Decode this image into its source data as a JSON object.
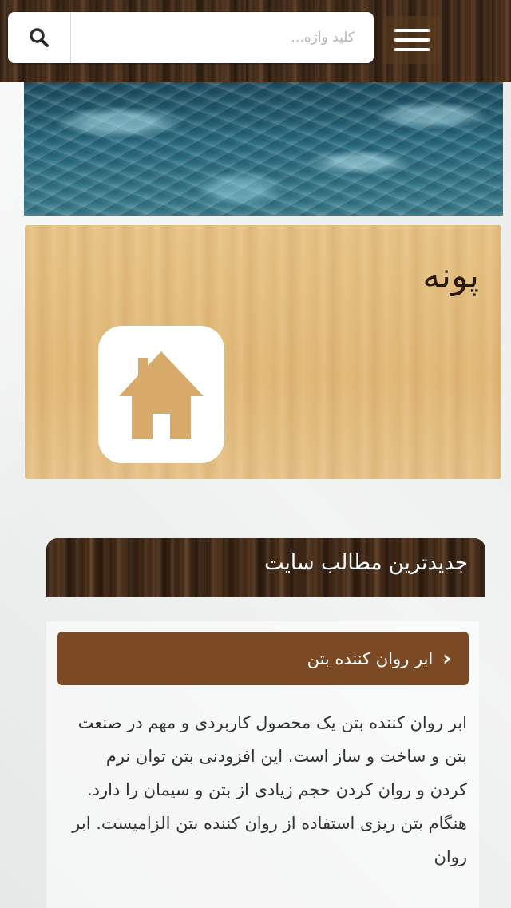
{
  "search": {
    "placeholder": "کلید واژه..."
  },
  "site": {
    "title": "پونه"
  },
  "section": {
    "title": "جدیدترین مطالب سایت"
  },
  "post": {
    "title": "ابر روان کننده بتن",
    "excerpt": "ابر روان کننده بتن یک محصول کاربردی و مهم در صنعت بتن و ساخت و ساز است. این افزودنی بتن توان نرم کردن و روان کردن حجم زیادی از بتن و سیمان را دارد. هنگام بتن ریزی استفاده از روان کننده بتن الزامیست. ابر روان"
  },
  "icons": {
    "search": "search-icon",
    "menu": "hamburger-menu-icon",
    "logo": "home-icon",
    "chevron": "chevron-right-icon"
  },
  "colors": {
    "header_wood": "#3a2616",
    "card_wood": "#e6c185",
    "post_head": "#7b4a25"
  }
}
